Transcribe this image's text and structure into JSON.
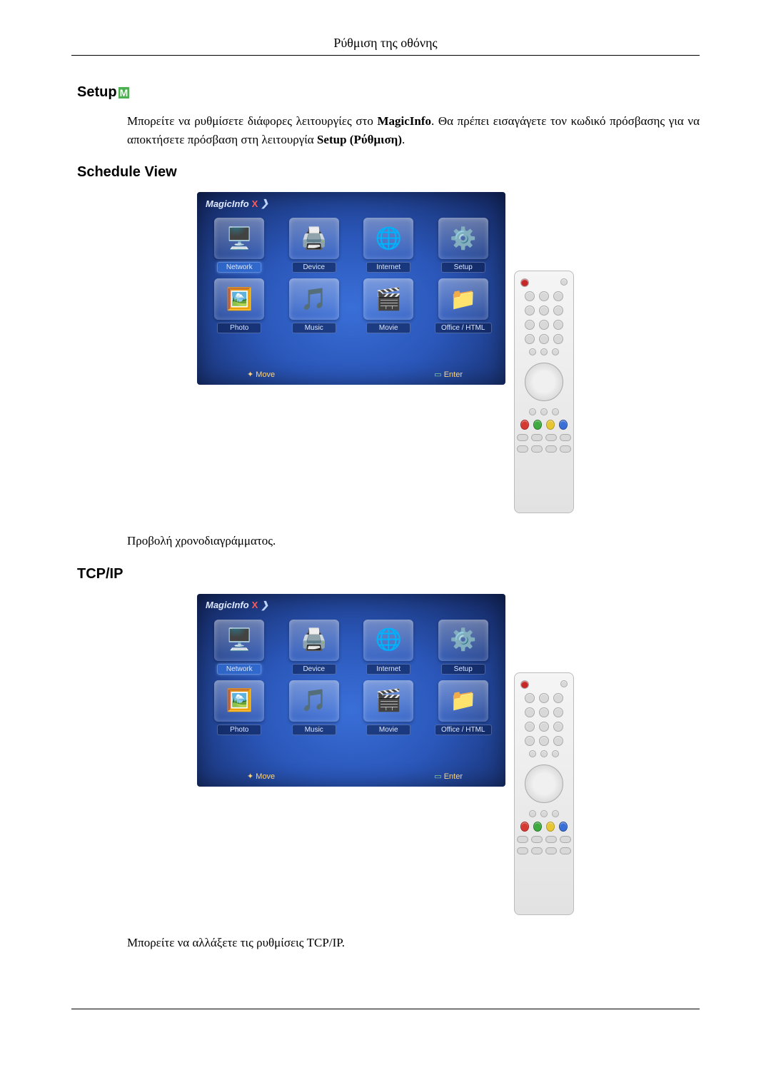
{
  "page_header": "Ρύθμιση της οθόνης",
  "sections": {
    "setup": {
      "heading": "Setup",
      "badge": "M",
      "paragraph_pre": "Μπορείτε να ρυθμίσετε διάφορες λειτουργίες στο ",
      "paragraph_bold1": "MagicInfo",
      "paragraph_mid": ". Θα πρέπει εισαγάγετε τον κωδικό πρόσβασης για να αποκτήσετε πρόσβαση στη λειτουργία ",
      "paragraph_bold2": "Setup (Ρύθμιση)",
      "paragraph_post": "."
    },
    "schedule": {
      "heading": "Schedule View",
      "caption": "Προβολή χρονοδιαγράμματος."
    },
    "tcpip": {
      "heading": "TCP/IP",
      "caption": "Μπορείτε να αλλάξετε τις ρυθμίσεις TCP/IP."
    }
  },
  "screen": {
    "brand": "MagicInfo",
    "x": "X",
    "tiles": {
      "network": "Network",
      "device": "Device",
      "internet": "Internet",
      "setup": "Setup",
      "photo": "Photo",
      "music": "Music",
      "movie": "Movie",
      "office": "Office / HTML"
    },
    "footer_move": "Move",
    "footer_enter": "Enter"
  }
}
